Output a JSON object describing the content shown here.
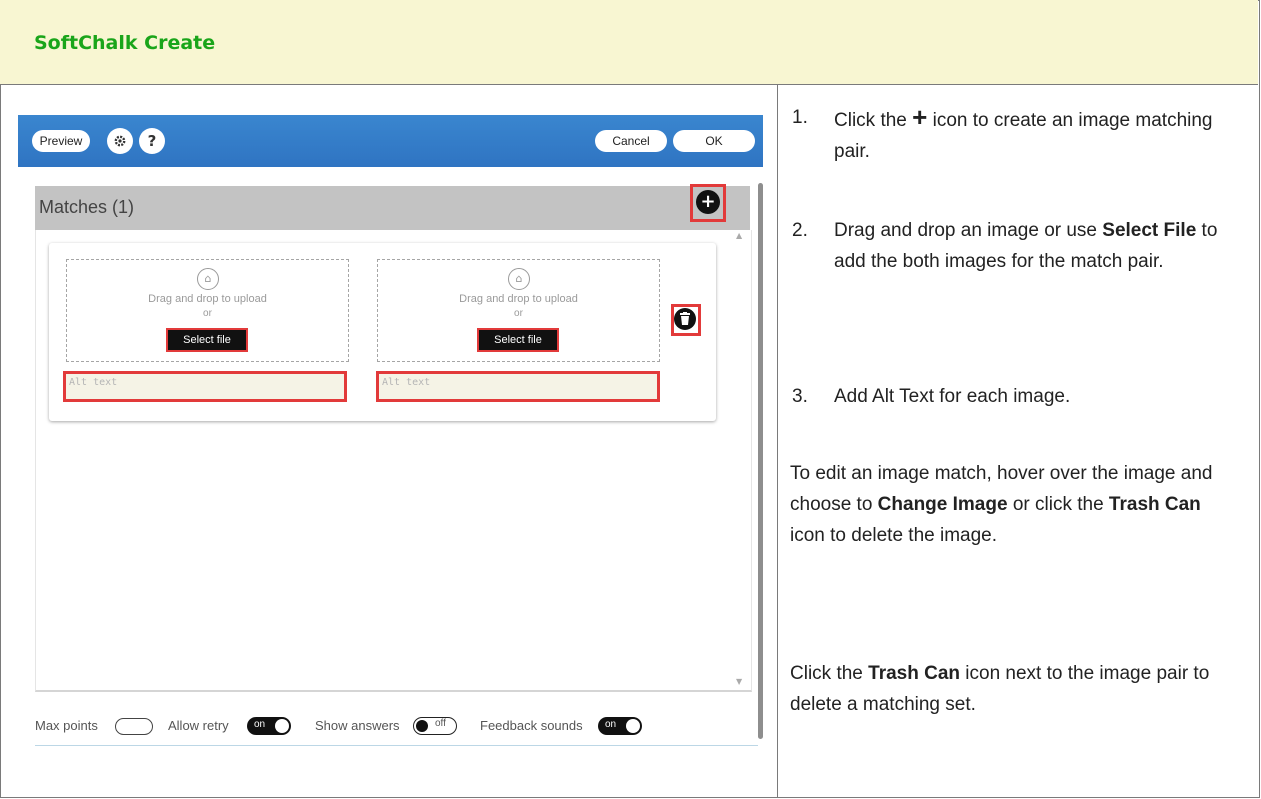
{
  "header": {
    "title": "SoftChalk Create"
  },
  "editor": {
    "toolbar": {
      "preview_label": "Preview",
      "settings_icon": "gear-icon",
      "help_label": "?",
      "cancel_label": "Cancel",
      "ok_label": "OK"
    },
    "matches_title": "Matches (1)",
    "add_icon": "+",
    "pairs": [
      {
        "left": {
          "drop_text": "Drag and drop to upload",
          "or_text": "or",
          "select_label": "Select file",
          "alt_placeholder": "Alt text"
        },
        "right": {
          "drop_text": "Drag and drop to upload",
          "or_text": "or",
          "select_label": "Select file",
          "alt_placeholder": "Alt text"
        }
      }
    ],
    "footer": {
      "max_points_label": "Max points",
      "allow_retry_label": "Allow retry",
      "allow_retry_state": "on",
      "show_answers_label": "Show answers",
      "show_answers_state": "off",
      "feedback_sounds_label": "Feedback sounds",
      "feedback_sounds_state": "on"
    }
  },
  "instructions": {
    "step1": {
      "num": "1.",
      "text_a": "Click the ",
      "icon": "+",
      "text_b": " icon to create an image matching pair."
    },
    "step2": {
      "num": "2.",
      "text_a": "Drag and drop an image or use ",
      "bold": "Select File",
      "text_b": " to add the both images for the match pair."
    },
    "step3": {
      "num": "3.",
      "text": "Add Alt Text for each image."
    },
    "edit": {
      "text_a": "To edit an image match, hover over the image and choose to ",
      "bold1": "Change Image",
      "text_b": " or click the ",
      "bold2": "Trash Can",
      "text_c": " icon to delete the image."
    },
    "delete": {
      "text_a": "Click the ",
      "bold": "Trash Can",
      "text_b": " icon next to the image pair to delete a matching set."
    }
  }
}
